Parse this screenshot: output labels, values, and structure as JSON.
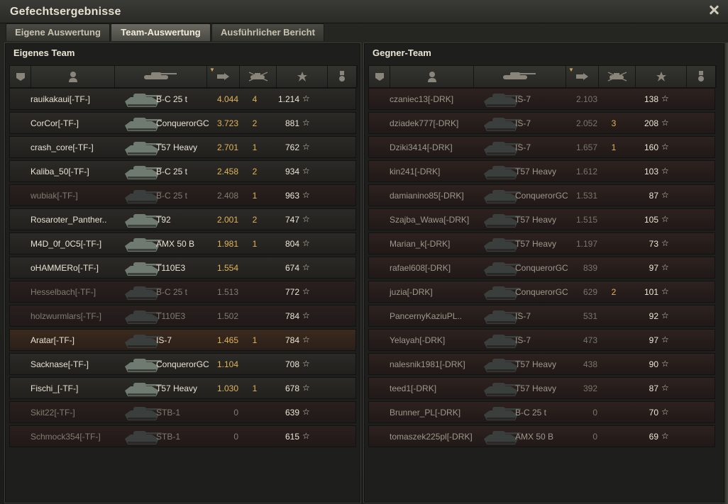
{
  "window": {
    "title": "Gefechtsergebnisse"
  },
  "tabs": [
    {
      "label": "Eigene Auswertung",
      "active": false
    },
    {
      "label": "Team-Auswertung",
      "active": true
    },
    {
      "label": "Ausführlicher Bericht",
      "active": false
    }
  ],
  "left": {
    "title": "Eigenes Team",
    "players": [
      {
        "name": "rauikakaui[-TF-]",
        "vehicle": "B-C 25 t",
        "damage": "4.044",
        "kills": "4",
        "xp": "1.214",
        "status": "alive"
      },
      {
        "name": "CorCor[-TF-]",
        "vehicle": "ConquerorGC",
        "damage": "3.723",
        "kills": "2",
        "xp": "881",
        "status": "alive"
      },
      {
        "name": "crash_core[-TF-]",
        "vehicle": "T57 Heavy",
        "damage": "2.701",
        "kills": "1",
        "xp": "762",
        "status": "alive"
      },
      {
        "name": "Kaliba_50[-TF-]",
        "vehicle": "B-C 25 t",
        "damage": "2.458",
        "kills": "2",
        "xp": "934",
        "status": "alive"
      },
      {
        "name": "wubiak[-TF-]",
        "vehicle": "B-C 25 t",
        "damage": "2.408",
        "kills": "1",
        "xp": "963",
        "status": "dead"
      },
      {
        "name": "Rosaroter_Panther..",
        "vehicle": "T92",
        "damage": "2.001",
        "kills": "2",
        "xp": "747",
        "status": "alive"
      },
      {
        "name": "M4D_0f_0C5[-TF-]",
        "vehicle": "AMX 50 B",
        "damage": "1.981",
        "kills": "1",
        "xp": "804",
        "status": "alive"
      },
      {
        "name": "oHAMMERo[-TF-]",
        "vehicle": "T110E3",
        "damage": "1.554",
        "kills": "",
        "xp": "674",
        "status": "alive"
      },
      {
        "name": "Hesselbach[-TF-]",
        "vehicle": "B-C 25 t",
        "damage": "1.513",
        "kills": "",
        "xp": "772",
        "status": "dead"
      },
      {
        "name": "holzwurmlars[-TF-]",
        "vehicle": "T110E3",
        "damage": "1.502",
        "kills": "",
        "xp": "784",
        "status": "dead"
      },
      {
        "name": "Aratar[-TF-]",
        "vehicle": "IS-7",
        "damage": "1.465",
        "kills": "1",
        "xp": "784",
        "status": "dead-orange"
      },
      {
        "name": "Sacknase[-TF-]",
        "vehicle": "ConquerorGC",
        "damage": "1.104",
        "kills": "",
        "xp": "708",
        "status": "alive"
      },
      {
        "name": "Fischi_[-TF-]",
        "vehicle": "T57 Heavy",
        "damage": "1.030",
        "kills": "1",
        "xp": "678",
        "status": "alive"
      },
      {
        "name": "Skit22[-TF-]",
        "vehicle": "STB-1",
        "damage": "0",
        "kills": "",
        "xp": "639",
        "status": "dead"
      },
      {
        "name": "Schmock354[-TF-]",
        "vehicle": "STB-1",
        "damage": "0",
        "kills": "",
        "xp": "615",
        "status": "dead"
      }
    ]
  },
  "right": {
    "title": "Gegner-Team",
    "players": [
      {
        "name": "czaniec13[-DRK]",
        "vehicle": "IS-7",
        "damage": "2.103",
        "kills": "",
        "xp": "138"
      },
      {
        "name": "dziadek777[-DRK]",
        "vehicle": "IS-7",
        "damage": "2.052",
        "kills": "3",
        "xp": "208"
      },
      {
        "name": "Dziki3414[-DRK]",
        "vehicle": "IS-7",
        "damage": "1.657",
        "kills": "1",
        "xp": "160"
      },
      {
        "name": "kin241[-DRK]",
        "vehicle": "T57 Heavy",
        "damage": "1.612",
        "kills": "",
        "xp": "103"
      },
      {
        "name": "damianino85[-DRK]",
        "vehicle": "ConquerorGC",
        "damage": "1.531",
        "kills": "",
        "xp": "87"
      },
      {
        "name": "Szajba_Wawa[-DRK]",
        "vehicle": "T57 Heavy",
        "damage": "1.515",
        "kills": "",
        "xp": "105"
      },
      {
        "name": "Marian_k[-DRK]",
        "vehicle": "T57 Heavy",
        "damage": "1.197",
        "kills": "",
        "xp": "73"
      },
      {
        "name": "rafael608[-DRK]",
        "vehicle": "ConquerorGC",
        "damage": "839",
        "kills": "",
        "xp": "97"
      },
      {
        "name": "juzia[-DRK]",
        "vehicle": "ConquerorGC",
        "damage": "629",
        "kills": "2",
        "xp": "101"
      },
      {
        "name": "PancernyKaziuPL..",
        "vehicle": "IS-7",
        "damage": "531",
        "kills": "",
        "xp": "92"
      },
      {
        "name": "Yelayah[-DRK]",
        "vehicle": "IS-7",
        "damage": "473",
        "kills": "",
        "xp": "97"
      },
      {
        "name": "nalesnik1981[-DRK]",
        "vehicle": "T57 Heavy",
        "damage": "438",
        "kills": "",
        "xp": "90"
      },
      {
        "name": "teed1[-DRK]",
        "vehicle": "T57 Heavy",
        "damage": "392",
        "kills": "",
        "xp": "87"
      },
      {
        "name": "Brunner_PL[-DRK]",
        "vehicle": "B-C 25 t",
        "damage": "0",
        "kills": "",
        "xp": "70"
      },
      {
        "name": "tomaszek225pl[-DRK]",
        "vehicle": "AMX 50 B",
        "damage": "0",
        "kills": "",
        "xp": "69"
      }
    ]
  },
  "columns": [
    {
      "icon": "squad-icon"
    },
    {
      "icon": "player-icon"
    },
    {
      "icon": "tank-icon"
    },
    {
      "icon": "damage-icon",
      "sorted": true
    },
    {
      "icon": "kills-icon"
    },
    {
      "icon": "xp-star-icon"
    },
    {
      "icon": "medal-icon"
    }
  ],
  "colors": {
    "damage": "#e0b45a",
    "kills": "#e0b45a",
    "text": "#e8e2d2",
    "dead_text": "#827b70"
  },
  "symbols": {
    "star": "☆",
    "sort": "▼"
  }
}
